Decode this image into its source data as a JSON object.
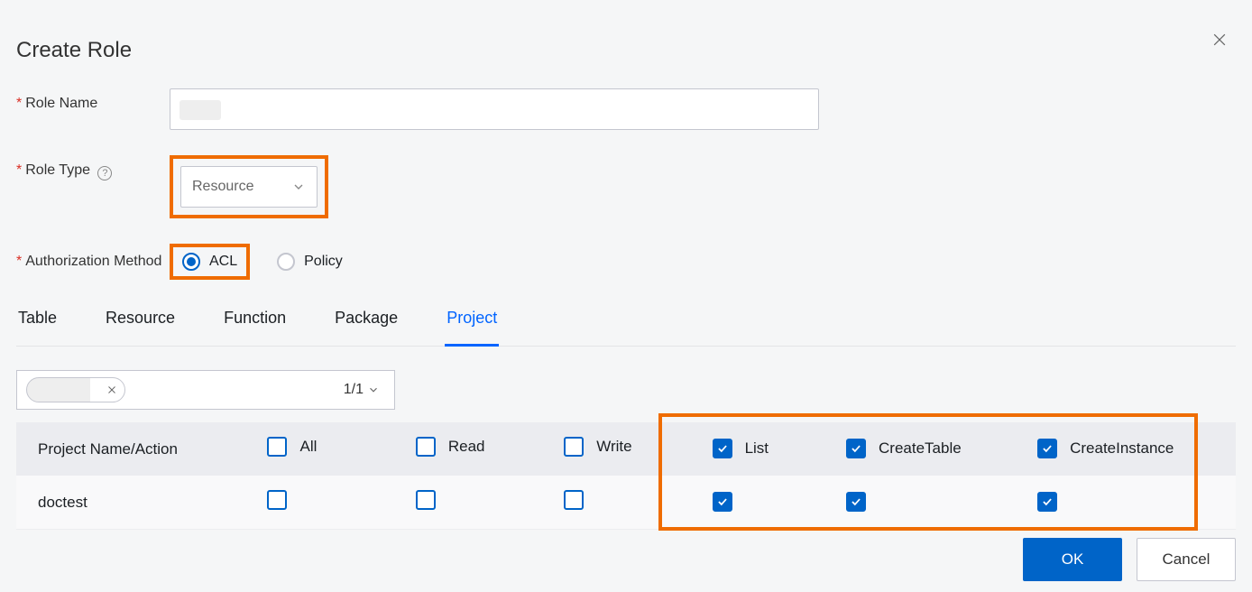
{
  "dialog": {
    "title": "Create Role",
    "labels": {
      "role_name": "Role Name",
      "role_type": "Role Type",
      "auth_method": "Authorization Method"
    },
    "role_type_value": "Resource",
    "auth_methods": {
      "acl": "ACL",
      "policy": "Policy",
      "selected": "acl"
    }
  },
  "tabs": [
    {
      "label": "Table",
      "active": false
    },
    {
      "label": "Resource",
      "active": false
    },
    {
      "label": "Function",
      "active": false
    },
    {
      "label": "Package",
      "active": false
    },
    {
      "label": "Project",
      "active": true
    }
  ],
  "filter": {
    "page_indicator": "1/1"
  },
  "table": {
    "headers": {
      "name": "Project Name/Action",
      "all": "All",
      "read": "Read",
      "write": "Write",
      "list": "List",
      "create_table": "CreateTable",
      "create_instance": "CreateInstance"
    },
    "header_checked": {
      "all": false,
      "read": false,
      "write": false,
      "list": true,
      "create_table": true,
      "create_instance": true
    },
    "rows": [
      {
        "name": "doctest",
        "all": false,
        "read": false,
        "write": false,
        "list": true,
        "create_table": true,
        "create_instance": true
      }
    ]
  },
  "footer": {
    "ok": "OK",
    "cancel": "Cancel"
  }
}
